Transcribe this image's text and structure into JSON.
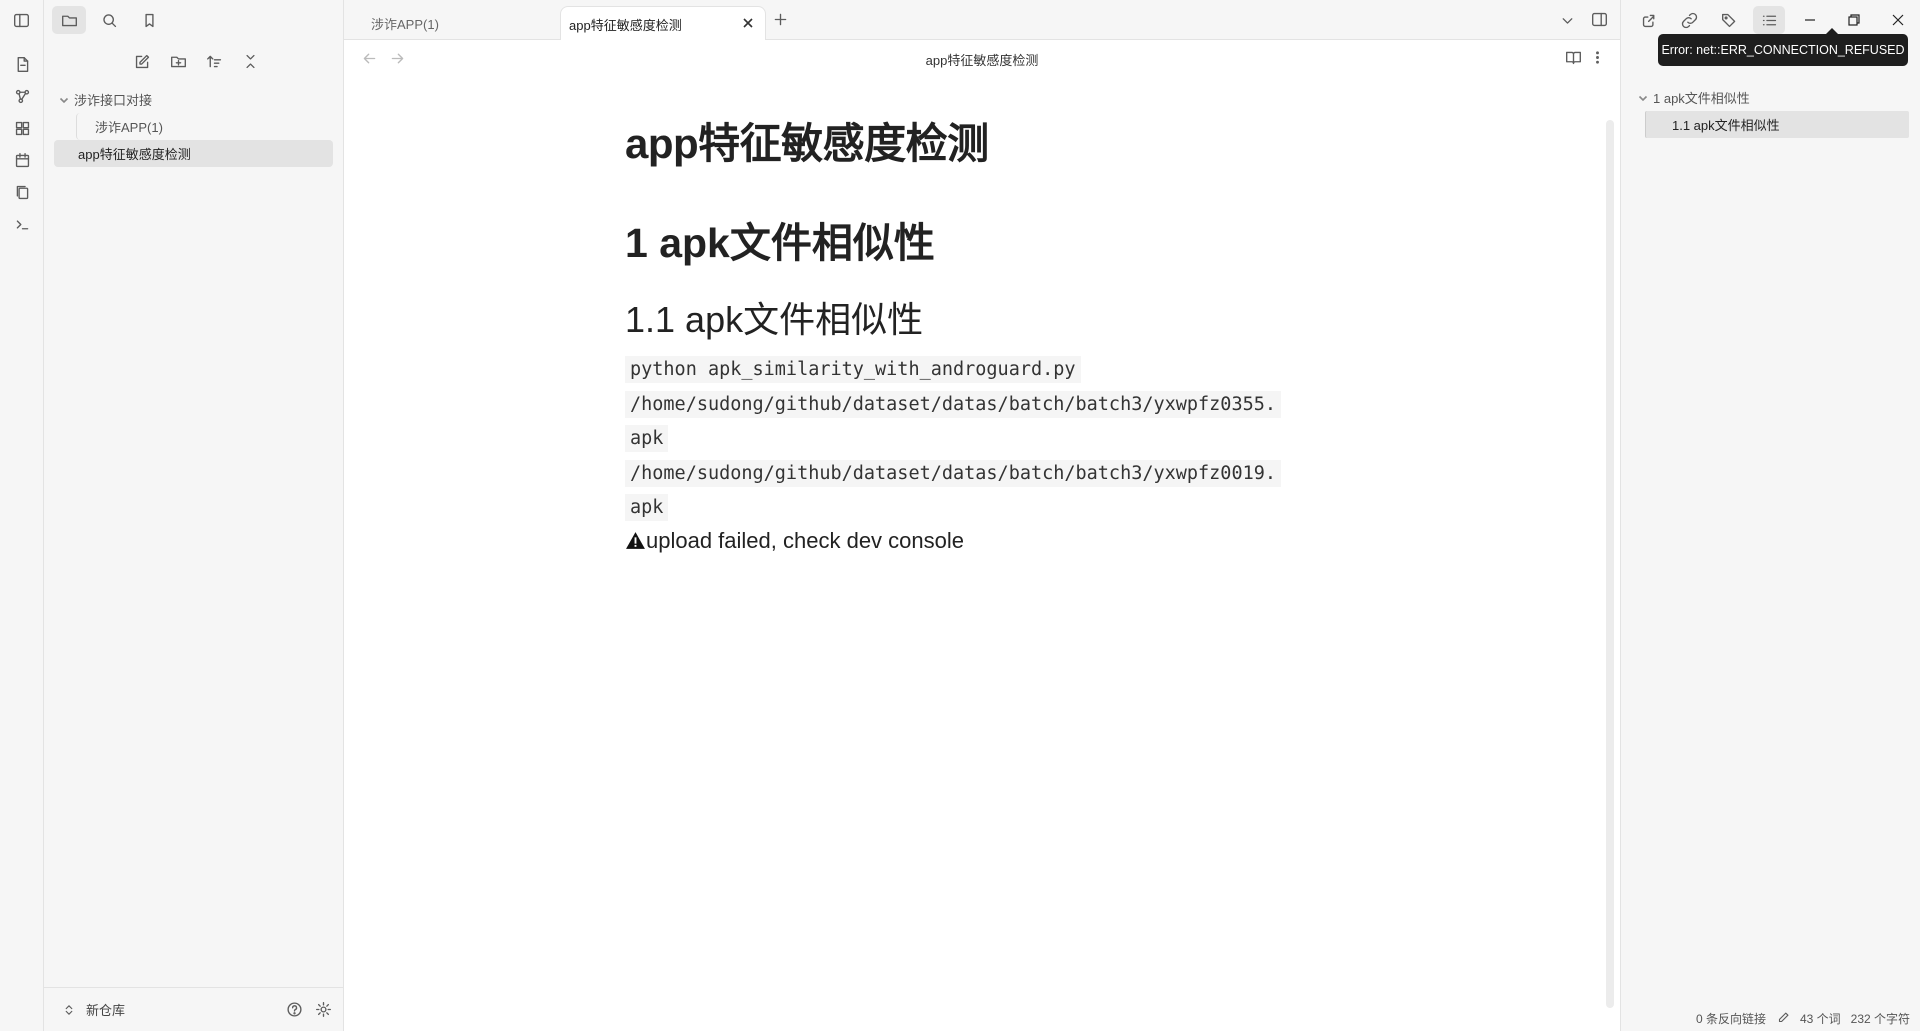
{
  "tabs": [
    {
      "label": "涉诈APP(1)",
      "active": false
    },
    {
      "label": "app特征敏感度检测",
      "active": true
    }
  ],
  "explorer": {
    "folder": "涉诈接口对接",
    "child_file": "涉诈APP(1)",
    "selected_file": "app特征敏感度检测",
    "vault": "新仓库"
  },
  "view": {
    "title": "app特征敏感度检测"
  },
  "doc": {
    "title": "app特征敏感度检测",
    "h1": "1 apk文件相似性",
    "h2": "1.1 apk文件相似性",
    "code_lines": [
      "python apk_similarity_with_androguard.py ",
      "/home/sudong/github/dataset/datas/batch/batch3/yxwpfz0355.",
      "apk ",
      "/home/sudong/github/dataset/datas/batch/batch3/yxwpfz0019.",
      "apk"
    ],
    "warning": "upload failed, check dev console"
  },
  "tooltip": "Error: net::ERR_CONNECTION_REFUSED",
  "outline": {
    "h1": "1 apk文件相似性",
    "h2": "1.1 apk文件相似性"
  },
  "status": {
    "backlinks": "0 条反向链接",
    "words": "43 个词",
    "chars": "232 个字符"
  }
}
